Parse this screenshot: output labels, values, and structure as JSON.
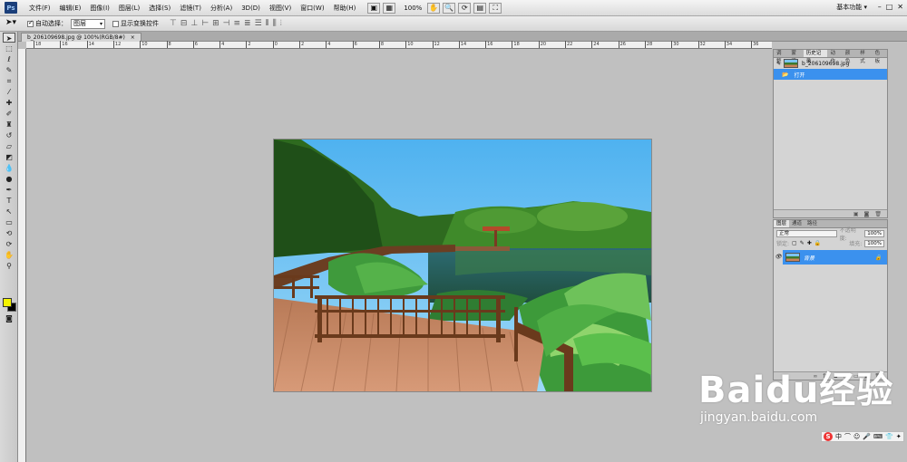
{
  "app": {
    "logo": "Ps",
    "workspace": "基本功能 ▾",
    "window_controls": [
      "–",
      "□",
      "✕"
    ]
  },
  "menu": [
    "文件(F)",
    "编辑(E)",
    "图像(I)",
    "图层(L)",
    "选择(S)",
    "滤镜(T)",
    "分析(A)",
    "3D(D)",
    "视图(V)",
    "窗口(W)",
    "帮助(H)"
  ],
  "zoom": "100%",
  "options": {
    "auto_select_label": "自动选择：",
    "auto_select_checked": true,
    "auto_select_value": "图层",
    "show_transform_label": "显示变换控件",
    "show_transform_checked": false
  },
  "document": {
    "tab_title": "b_206109698.jpg @ 100%(RGB/8#)",
    "close": "×"
  },
  "ruler_top_labels": [
    "18",
    "16",
    "14",
    "12",
    "10",
    "8",
    "6",
    "4",
    "2",
    "0",
    "2",
    "4",
    "6",
    "8",
    "10",
    "12",
    "14",
    "16",
    "18",
    "20",
    "22",
    "24",
    "26",
    "28",
    "30",
    "32",
    "34",
    "36"
  ],
  "history_panel": {
    "tabs": [
      "调整",
      "蒙版",
      "历史记录",
      "动作",
      "颜色",
      "样式",
      "色板"
    ],
    "active_tab": "历史记录",
    "snapshot_name": "b_206109698.jpg",
    "items": [
      "打开"
    ]
  },
  "layers_panel": {
    "tabs": [
      "图层",
      "通道",
      "路径"
    ],
    "active_tab": "图层",
    "blend_mode": "正常",
    "opacity_label": "不透明度:",
    "opacity_value": "100%",
    "lock_label": "锁定:",
    "fill_label": "填充:",
    "fill_value": "100%",
    "layer_name": "背景"
  },
  "colors": {
    "foreground": "#f5f500",
    "background": "#000000",
    "selection": "#3b91ee"
  },
  "watermark": {
    "brand": "Baidu经验",
    "url": "jingyan.baidu.com"
  }
}
